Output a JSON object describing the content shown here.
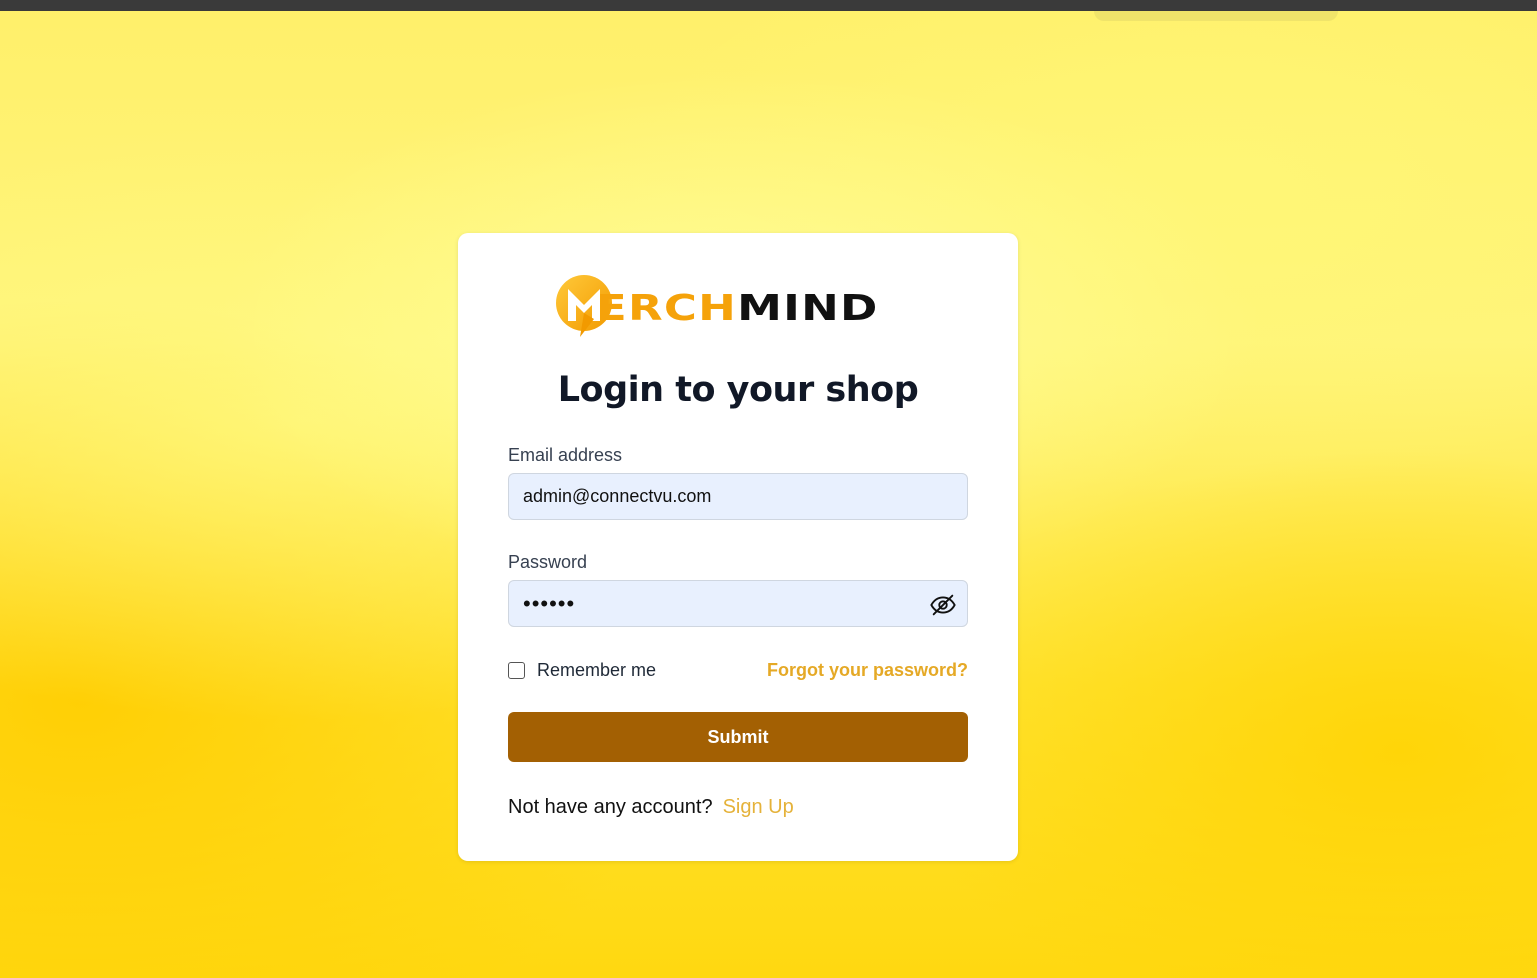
{
  "brand": {
    "logo_part1": "ERCH",
    "logo_part2": "MIND",
    "accent_color": "#f5a20a"
  },
  "login": {
    "title": "Login to your shop",
    "email_label": "Email address",
    "email_value": "admin@connectvu.com",
    "password_label": "Password",
    "password_masked": "••••••",
    "password_toggle_icon": "eye-off-icon",
    "remember_label": "Remember me",
    "remember_checked": false,
    "forgot_label": "Forgot your password?",
    "submit_label": "Submit",
    "no_account_text": "Not have any account?",
    "signup_label": "Sign Up",
    "submit_color": "#a36003",
    "link_color": "#e5a926"
  }
}
